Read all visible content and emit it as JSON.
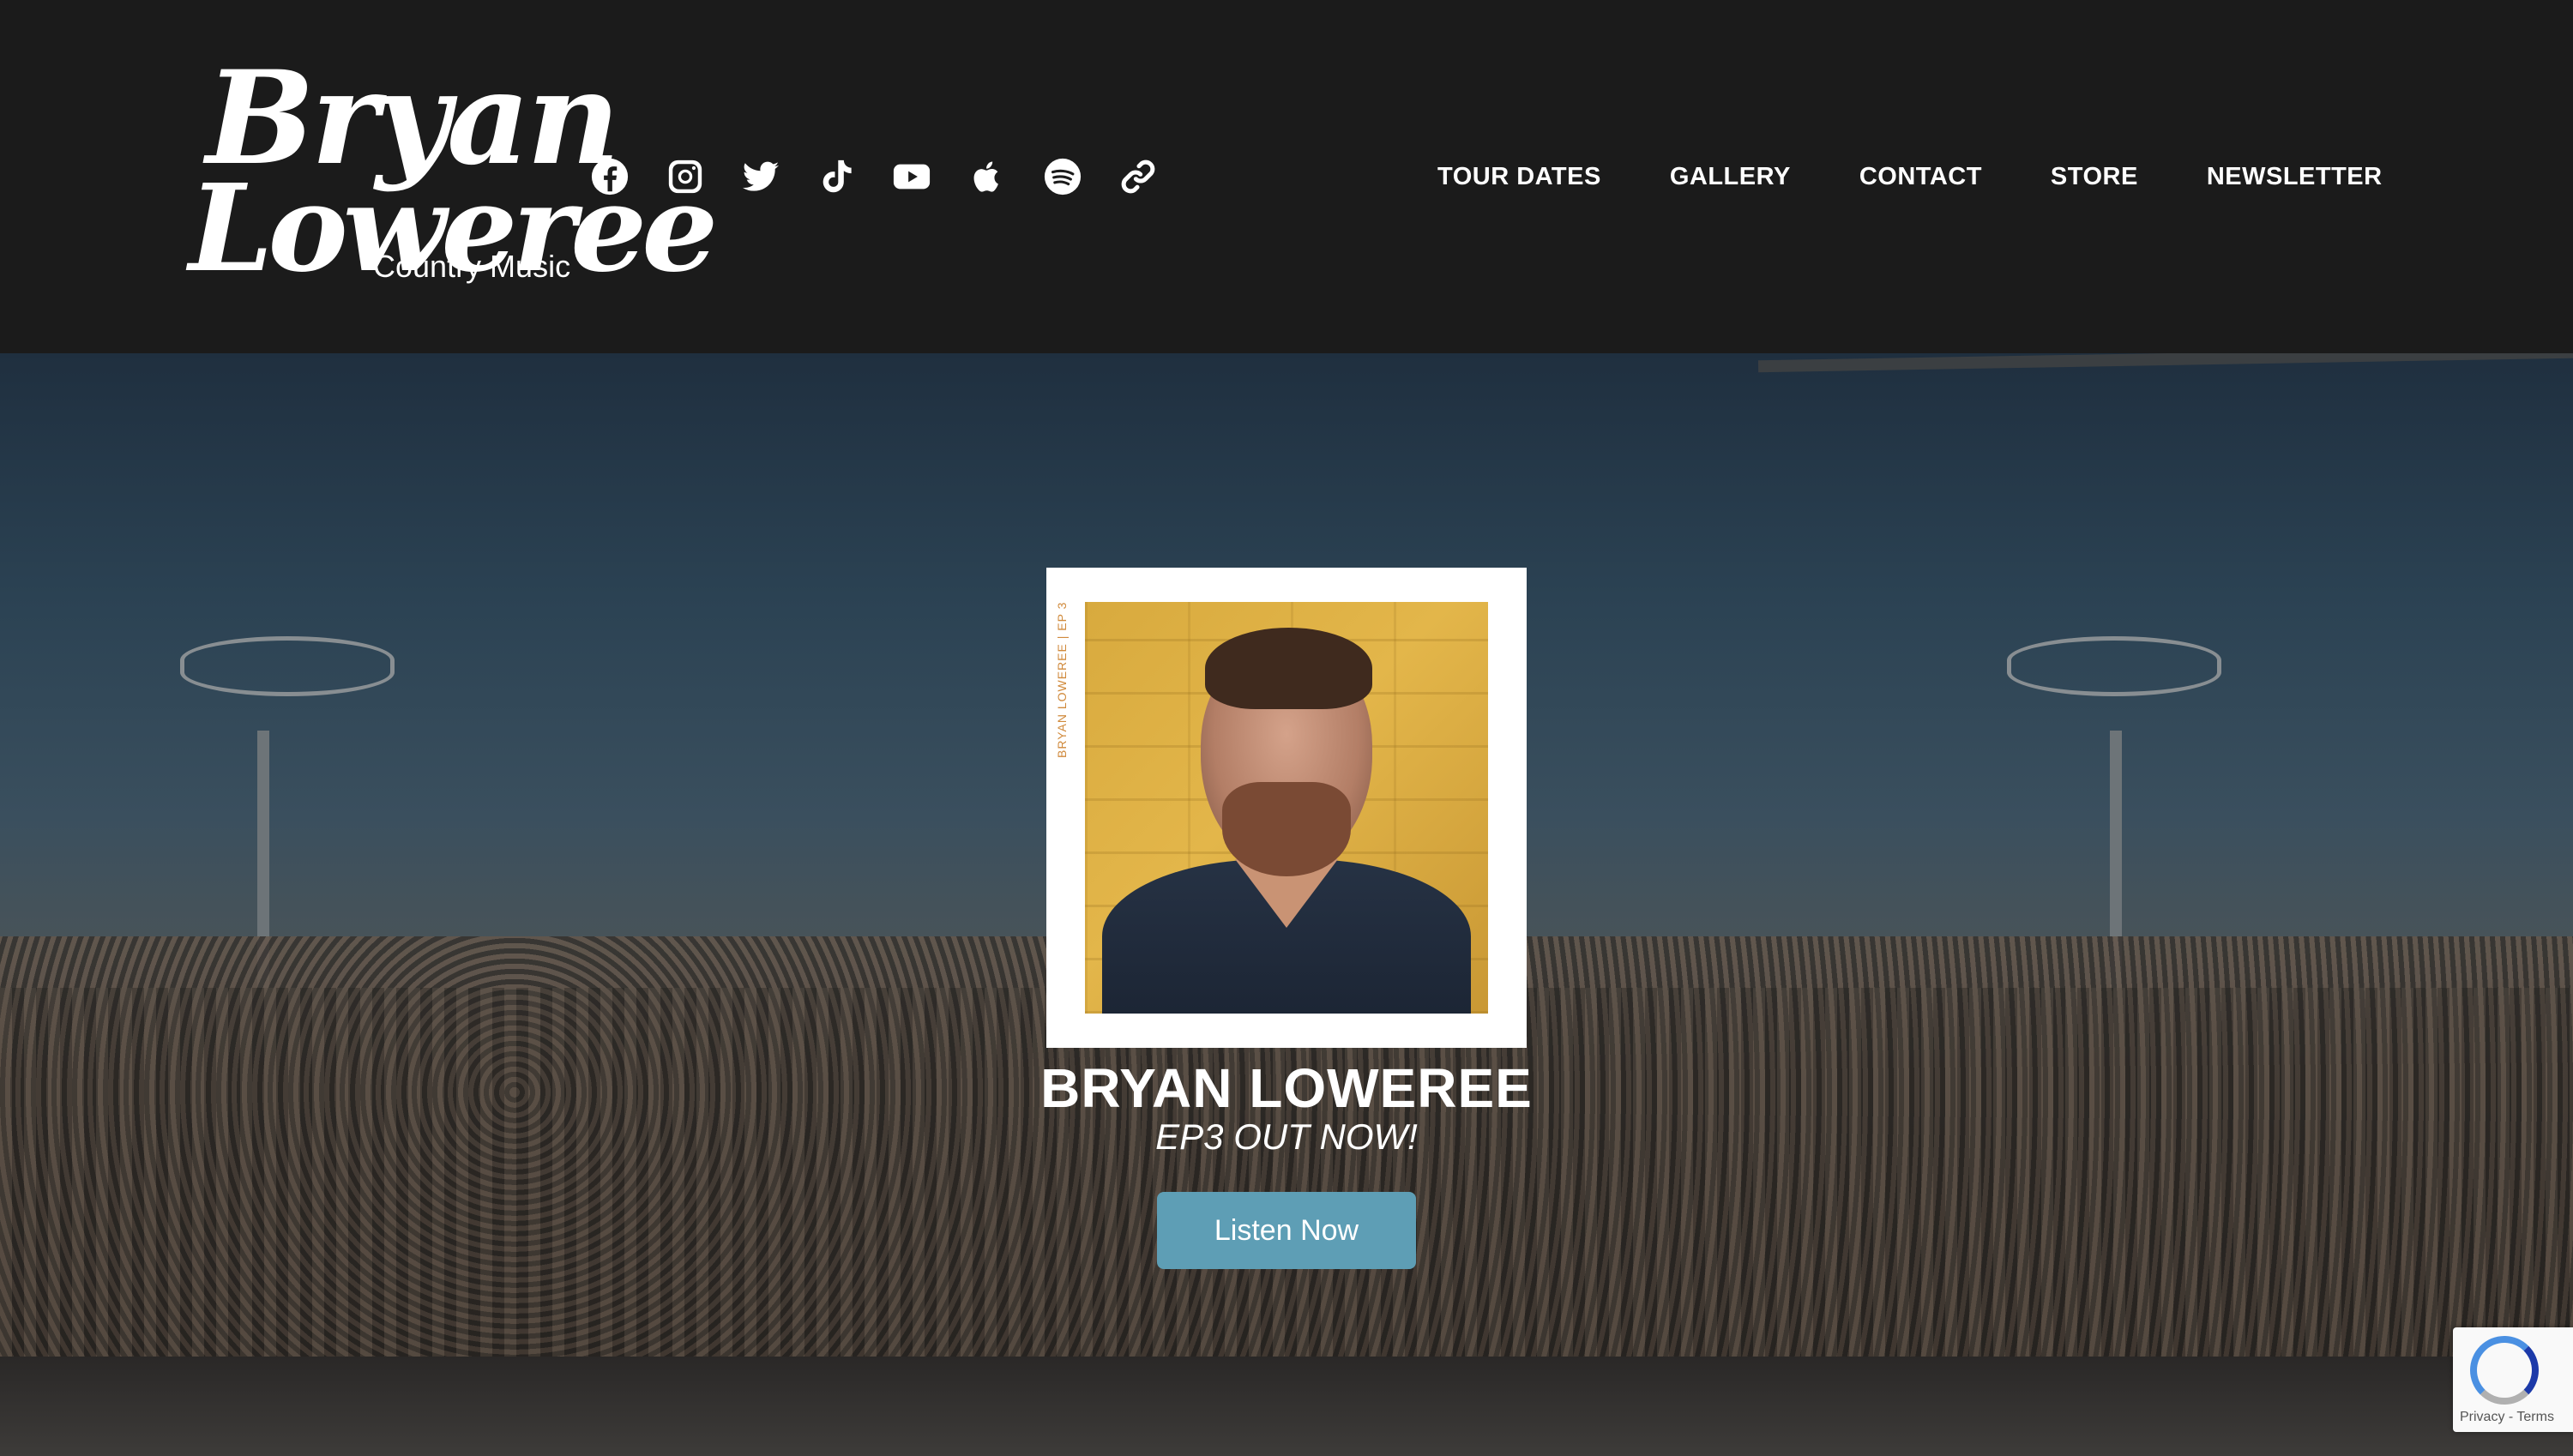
{
  "logo": {
    "line1": "Bryan",
    "line2": "Loweree",
    "subtitle": "Country Music"
  },
  "social_icons": [
    "facebook-icon",
    "instagram-icon",
    "twitter-icon",
    "tiktok-icon",
    "youtube-icon",
    "apple-icon",
    "spotify-icon",
    "link-icon"
  ],
  "nav": {
    "items": [
      {
        "label": "TOUR DATES"
      },
      {
        "label": "GALLERY"
      },
      {
        "label": "CONTACT"
      },
      {
        "label": "STORE"
      },
      {
        "label": "NEWSLETTER"
      }
    ]
  },
  "hero": {
    "album_side_text": "BRYAN LOWEREE | EP 3",
    "artist_name": "BRYAN LOWEREE",
    "tagline": "EP3 OUT NOW!",
    "cta_label": "Listen Now"
  },
  "recaptcha": {
    "text": "Privacy - Terms"
  },
  "colors": {
    "header_bg": "#1b1b1b",
    "button": "#5e9eb5",
    "album_accent": "#d08a3c"
  }
}
